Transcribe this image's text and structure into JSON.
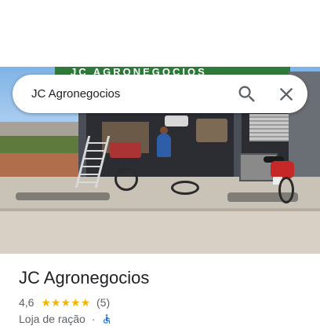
{
  "search": {
    "query": "JC Agronegocios",
    "search_icon": "search-icon",
    "close_icon": "close-icon"
  },
  "photo": {
    "signboard_text": "JC AGRONEGOCIOS"
  },
  "place": {
    "name": "JC Agronegocios",
    "rating": "4,6",
    "stars": "★★★★★",
    "review_count": "(5)",
    "category": "Loja de ração",
    "separator": "·",
    "accessibility_icon": "wheelchair-icon"
  },
  "colors": {
    "star": "#f4b400",
    "text_primary": "#202124",
    "text_secondary": "#5f6368",
    "accent": "#1a73e8"
  }
}
